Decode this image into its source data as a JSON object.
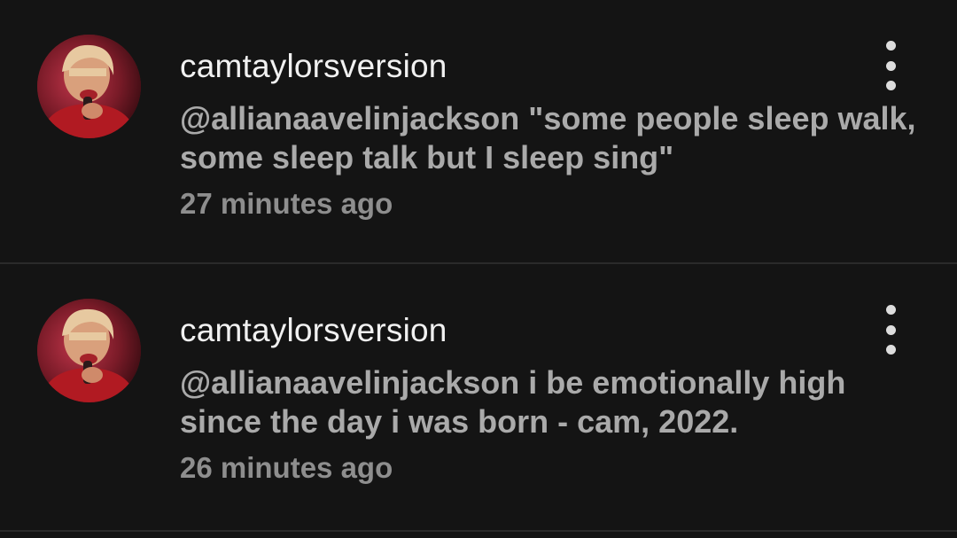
{
  "comments": [
    {
      "author": "camtaylorsversion",
      "text": "@allianaavelinjackson \"some people sleep walk, some sleep talk but I sleep sing\"",
      "time": "27 minutes ago",
      "avatar_icon": "profile-photo",
      "menu_icon": "more-vertical-icon"
    },
    {
      "author": "camtaylorsversion",
      "text": "@allianaavelinjackson i be emotionally high since the day i was born - cam, 2022.",
      "time": "26 minutes ago",
      "avatar_icon": "profile-photo",
      "menu_icon": "more-vertical-icon"
    }
  ],
  "colors": {
    "background": "#141414",
    "username": "#f1f1f1",
    "comment_text": "#aaaaaa",
    "timestamp": "#8e8e8e",
    "divider": "#2a2a2a"
  }
}
